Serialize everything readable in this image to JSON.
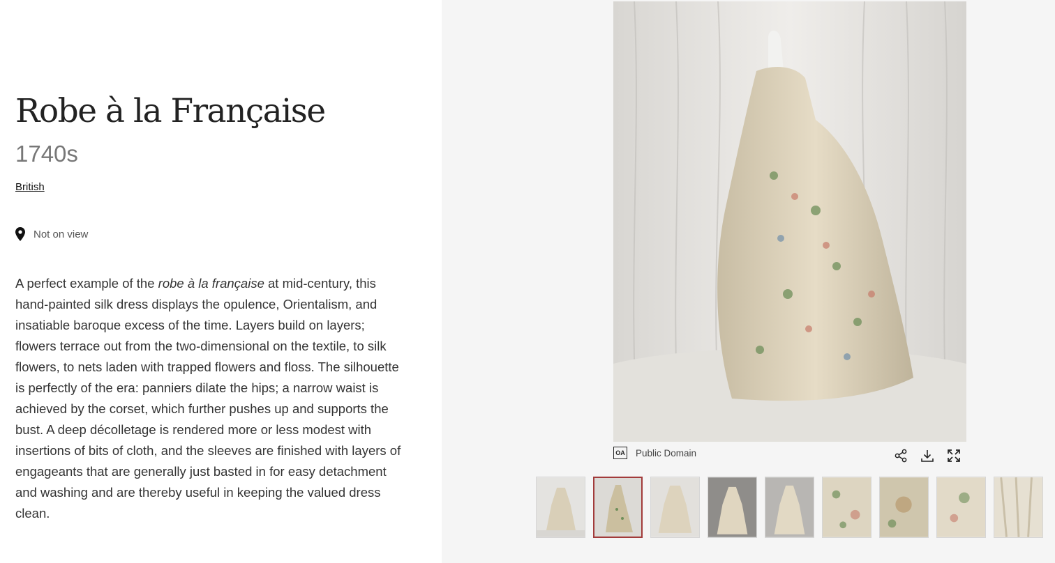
{
  "object": {
    "title": "Robe à la Française",
    "date": "1740s",
    "culture": "British",
    "location_status": "Not on view"
  },
  "description": {
    "intro": "A perfect example of the ",
    "italic_term": "robe à la française",
    "body": " at mid-century, this hand-painted silk dress displays the opulence, Orientalism, and insatiable baroque excess of the time. Layers build on layers; flowers terrace out from the two-dimensional on the textile, to silk flowers, to nets laden with trapped flowers and floss. The silhouette is perfectly of the era: panniers dilate the hips; a narrow waist is achieved by the corset, which further pushes up and supports the bust. A deep décolletage is rendered more or less modest with insertions of bits of cloth, and the sleeves are finished with layers of engageants that are generally just basted in for easy detachment and washing and are thereby useful in keeping the valued dress clean."
  },
  "image_viewer": {
    "rights_badge": "OA",
    "rights_label": "Public Domain",
    "icons": [
      "share-icon",
      "download-icon",
      "fullscreen-icon"
    ],
    "selected_thumbnail": 1,
    "thumbnail_count": 9
  },
  "colors": {
    "selected_border": "#a23b3b",
    "right_pane_bg": "#f5f5f5"
  }
}
